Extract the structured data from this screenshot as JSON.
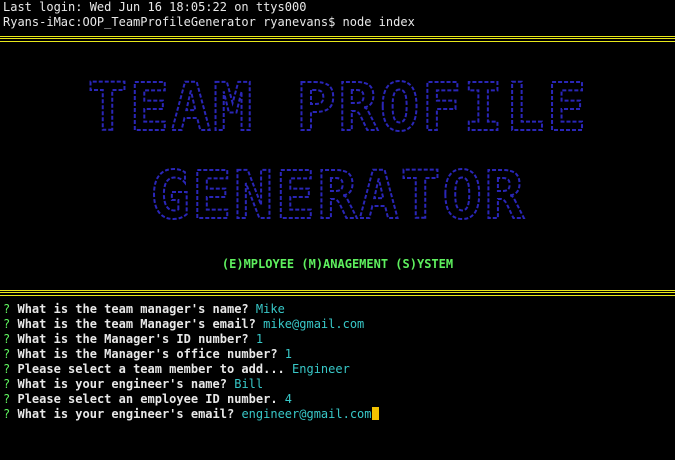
{
  "header": {
    "last_login": "Last login: Wed Jun 16 18:05:22 on ttys000",
    "prompt_line": "Ryans-iMac:OOP_TeamProfileGenerator ryanevans$ node index"
  },
  "banner": {
    "line1": "TEAM PROFILE",
    "line2": "GENERATOR",
    "subtitle": "(E)MPLOYEE (M)ANAGEMENT (S)YSTEM"
  },
  "colors": {
    "separator": "#e8e81a",
    "banner": "#2a26b8",
    "subtitle": "#5ef05e",
    "question_mark": "#5ef05e",
    "answer": "#38c8c8",
    "cursor": "#f2c200"
  },
  "prompts": [
    {
      "mark": "?",
      "question": "What is the team manager's name?",
      "answer": "Mike"
    },
    {
      "mark": "?",
      "question": "What is the team Manager's email?",
      "answer": "mike@gmail.com"
    },
    {
      "mark": "?",
      "question": "What is the Manager's ID number?",
      "answer": "1"
    },
    {
      "mark": "?",
      "question": "What is the Manager's office number?",
      "answer": "1"
    },
    {
      "mark": "?",
      "question": "Please select a team member to add...",
      "answer": "Engineer"
    },
    {
      "mark": "?",
      "question": "What is your engineer's name?",
      "answer": "Bill"
    },
    {
      "mark": "?",
      "question": "Please select an employee ID number.",
      "answer": "4"
    },
    {
      "mark": "?",
      "question": "What is your engineer's email?",
      "answer": "engineer@gmail.com"
    }
  ]
}
